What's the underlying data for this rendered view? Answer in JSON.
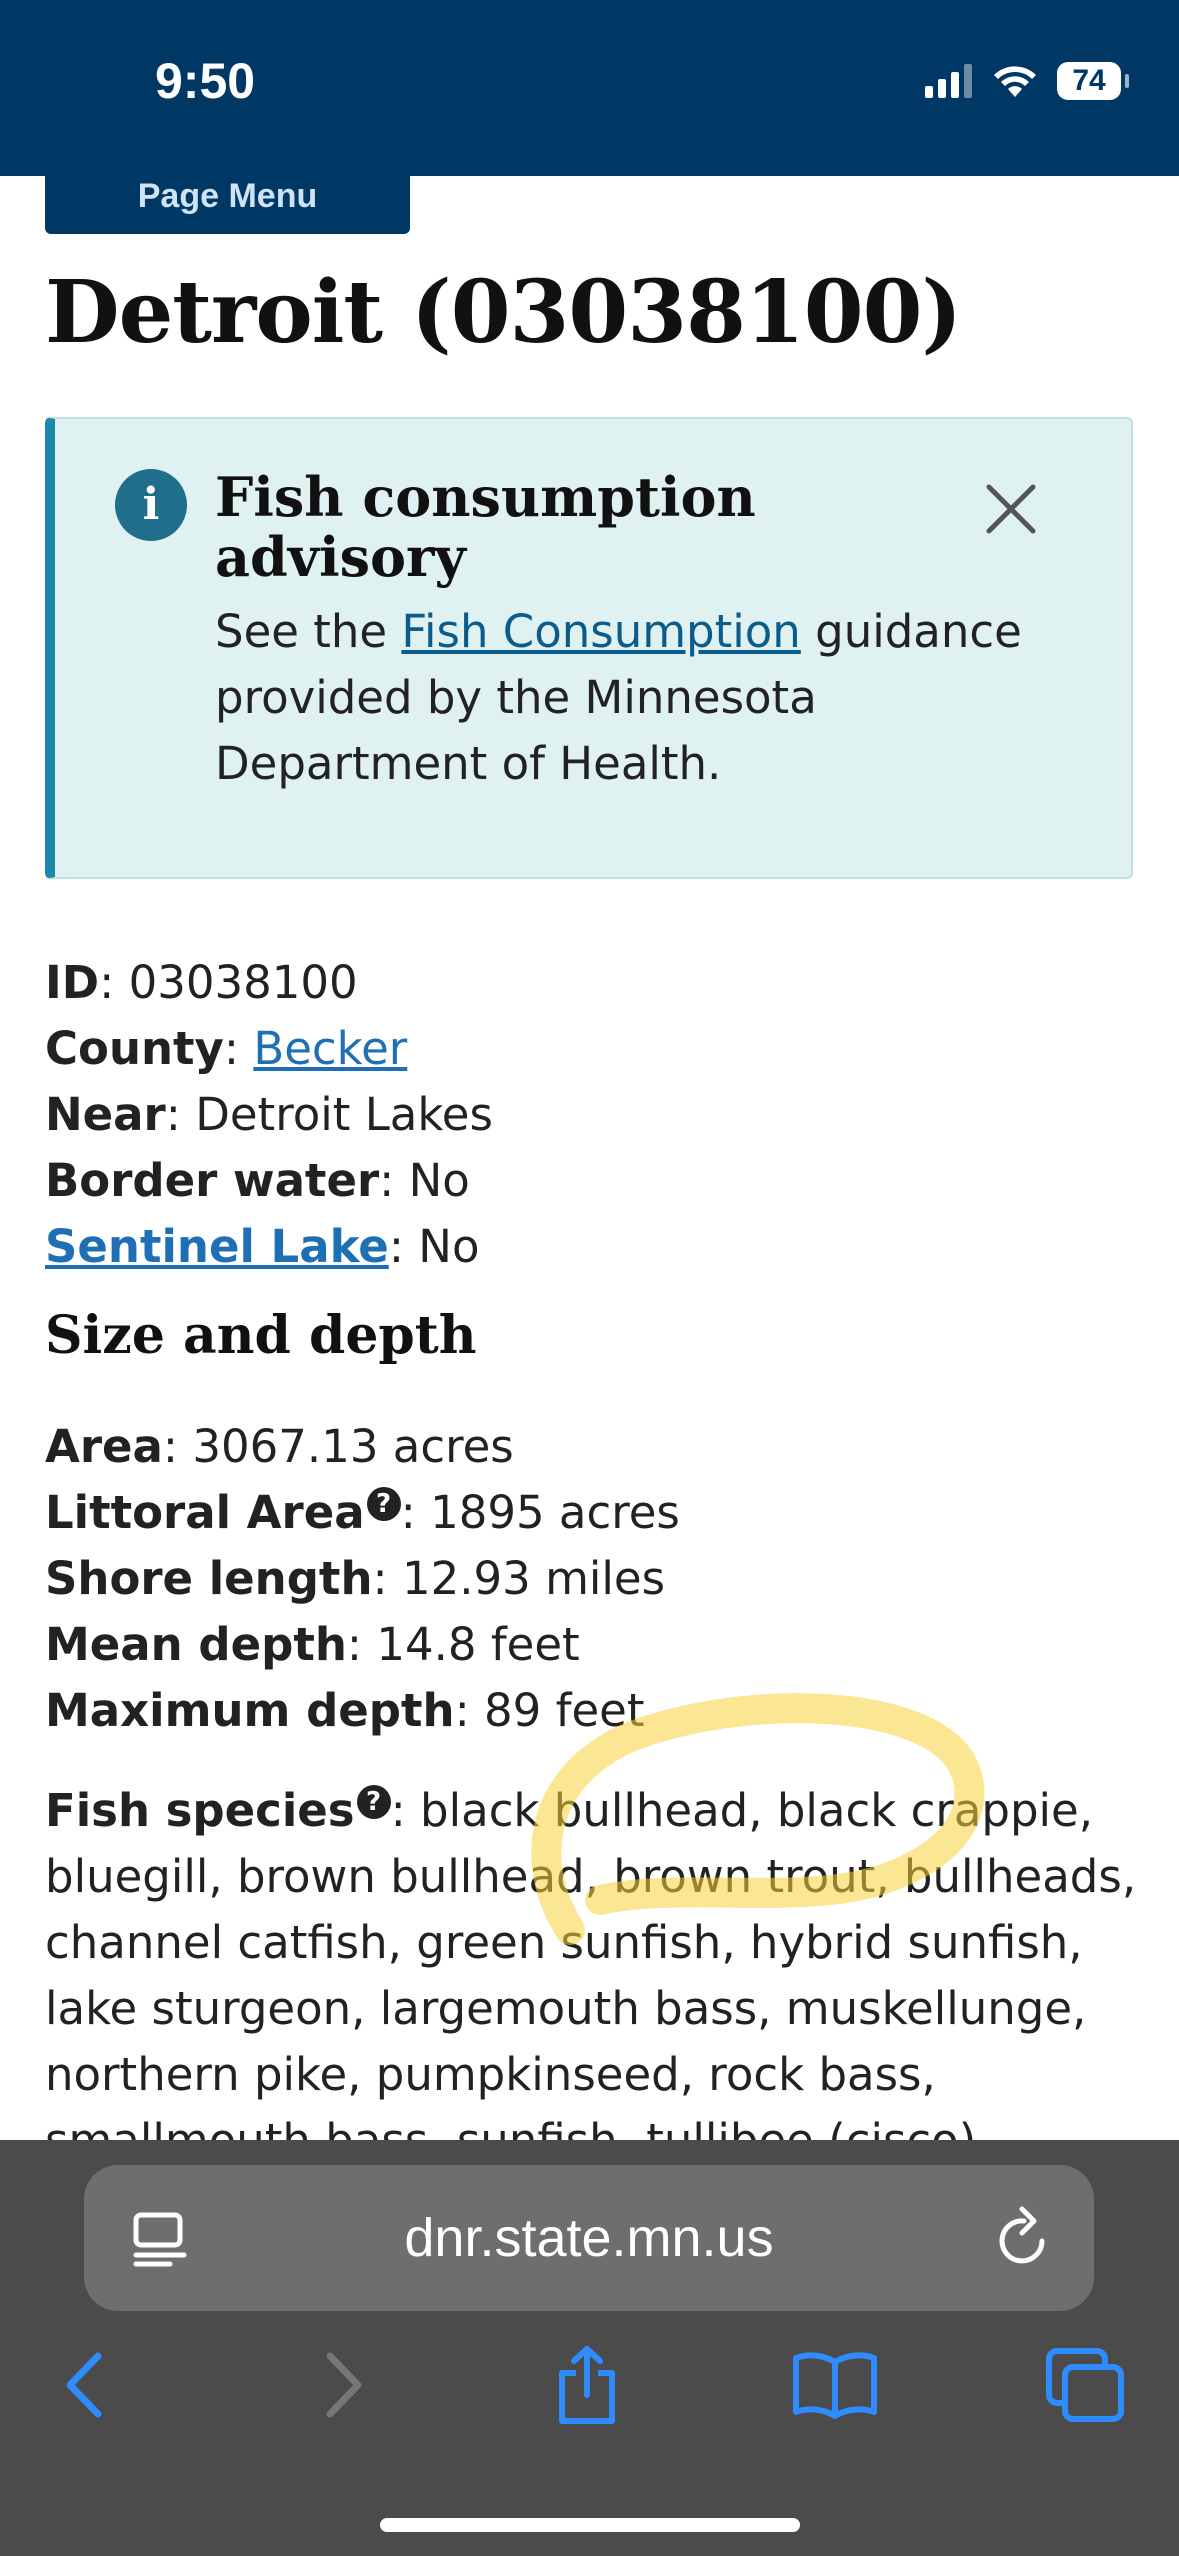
{
  "status": {
    "time": "9:50",
    "battery": "74"
  },
  "page_menu_label": "Page Menu",
  "title": "Detroit (03038100)",
  "advisory": {
    "title": "Fish consumption advisory",
    "body_pre": "See the ",
    "link_text": "Fish Consumption",
    "body_post": " guidance provided by the Minnesota Department of Health."
  },
  "facts": {
    "id_label": "ID",
    "id_value": "03038100",
    "county_label": "County",
    "county_value": "Becker",
    "near_label": "Near",
    "near_value": "Detroit Lakes",
    "border_label": "Border water",
    "border_value": "No",
    "sentinel_label": "Sentinel Lake",
    "sentinel_value": "No"
  },
  "size_heading": "Size and depth",
  "size": {
    "area_label": "Area",
    "area_value": "3067.13 acres",
    "littoral_label": "Littoral Area",
    "littoral_value": "1895 acres",
    "shore_label": "Shore length",
    "shore_value": "12.93 miles",
    "mean_label": "Mean depth",
    "mean_value": "14.8 feet",
    "max_label": "Maximum depth",
    "max_value": "89 feet"
  },
  "species": {
    "label": "Fish species",
    "value": "black bullhead, black crappie, bluegill, brown bullhead, brown trout, bullheads, channel catfish, green sunfish, hybrid sunfish, lake sturgeon, largemouth bass, muskellunge, northern pike, pumpkinseed, rock bass, smallmouth bass, sunfish, tullibee (cisco)"
  },
  "browser": {
    "url": "dnr.state.mn.us"
  },
  "colors": {
    "header": "#003865",
    "link": "#1f6fb5",
    "advisory_bg": "#e0f1f2",
    "highlight": "#f7d23a"
  },
  "icons": [
    "signal-icon",
    "wifi-icon",
    "info-icon",
    "close-icon",
    "help-icon",
    "reader-icon",
    "reload-icon",
    "back-icon",
    "forward-icon",
    "share-icon",
    "bookmarks-icon",
    "tabs-icon"
  ]
}
